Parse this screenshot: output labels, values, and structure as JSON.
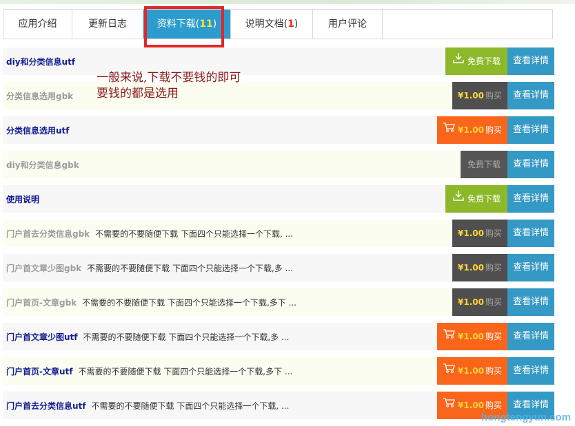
{
  "tabs": [
    {
      "label": "应用介绍",
      "count": "",
      "active": false
    },
    {
      "label": "更新日志",
      "count": "",
      "active": false
    },
    {
      "label": "资料下载",
      "count": "11",
      "active": true
    },
    {
      "label": "说明文档",
      "count": "1",
      "active": false
    },
    {
      "label": "用户评论",
      "count": "",
      "active": false
    }
  ],
  "annotation": {
    "line1": "一般来说,下载不要钱的即可",
    "line2": "要钱的都是选用"
  },
  "labels": {
    "detail": "查看详情",
    "free_download": "免费下载",
    "buy": "购买",
    "price": "¥1.00"
  },
  "rows": [
    {
      "title": "diy和分类信息utf",
      "desc": "",
      "style": "link",
      "action": "free"
    },
    {
      "title": "分类信息选用gbk",
      "desc": "",
      "style": "muted",
      "action": "buy-gray"
    },
    {
      "title": "分类信息选用utf",
      "desc": "",
      "style": "link",
      "action": "buy-orange"
    },
    {
      "title": "diy和分类信息gbk",
      "desc": "",
      "style": "muted",
      "action": "free-gray"
    },
    {
      "title": "使用说明",
      "desc": "",
      "style": "link",
      "action": "free"
    },
    {
      "title": "门户首去分类信息gbk",
      "desc": "不需要的不要随便下载 下面四个只能选择一个下载, ...",
      "style": "muted",
      "action": "buy-gray"
    },
    {
      "title": "门户首文章少图gbk",
      "desc": "不需要的不要随便下载 下面四个只能选择一个下载,多 ...",
      "style": "muted",
      "action": "buy-gray"
    },
    {
      "title": "门户首页-文章gbk",
      "desc": "不需要的不要随便下载 下面四个只能选择一个下载,多下 ...",
      "style": "muted",
      "action": "buy-gray"
    },
    {
      "title": "门户首文章少图utf",
      "desc": "不需要的不要随便下载 下面四个只能选择一个下载,多 ...",
      "style": "link",
      "action": "buy-orange"
    },
    {
      "title": "门户首页-文章utf",
      "desc": "不需要的不要随便下载 下面四个只能选择一个下载,多下 ...",
      "style": "link",
      "action": "buy-orange"
    },
    {
      "title": "门户首去分类信息utf",
      "desc": "不需要的不要随便下载 下面四个只能选择一个下载, ...",
      "style": "link",
      "action": "buy-orange"
    }
  ],
  "watermark": "hongtengyun.com"
}
